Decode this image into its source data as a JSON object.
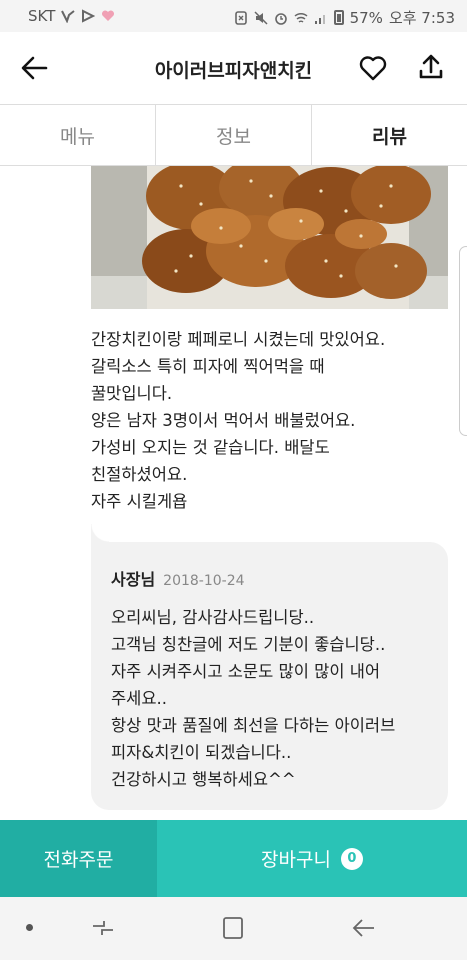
{
  "status_bar": {
    "carrier": "SKT",
    "battery": "57%",
    "time": "오후 7:53"
  },
  "header": {
    "title": "아이러브피자앤치킨",
    "back_icon": "arrow-left-icon",
    "favorite_icon": "heart-outline-icon",
    "share_icon": "share-upload-icon"
  },
  "tabs": [
    {
      "label": "메뉴",
      "active": false
    },
    {
      "label": "정보",
      "active": false
    },
    {
      "label": "리뷰",
      "active": true
    }
  ],
  "review": {
    "text": "간장치킨이랑 페페로니 시켰는데 맛있어요.\n갈릭소스 특히 피자에 찍어먹을 때\n꿀맛입니다.\n양은 남자 3명이서 먹어서 배불렀어요.\n가성비 오지는 것 같습니다. 배달도\n친절하셨어요.\n자주 시킬게욥"
  },
  "owner_reply": {
    "author": "사장님",
    "date": "2018-10-24",
    "text": "오리씨님, 감사감사드립니당..\n고객님 칭찬글에 저도 기분이 좋습니당..\n자주 시켜주시고 소문도 많이 많이 내어\n주세요..\n항상 맛과 품질에 최선을 다하는 아이러브\n피자&치킨이 되겠습니다..\n건강하시고 행복하세요^^"
  },
  "bottom_bar": {
    "call_order_label": "전화주문",
    "cart_label": "장바구니",
    "cart_count": "0"
  },
  "colors": {
    "call_order_bg": "#21aea3",
    "cart_bg": "#2ac3b6"
  }
}
